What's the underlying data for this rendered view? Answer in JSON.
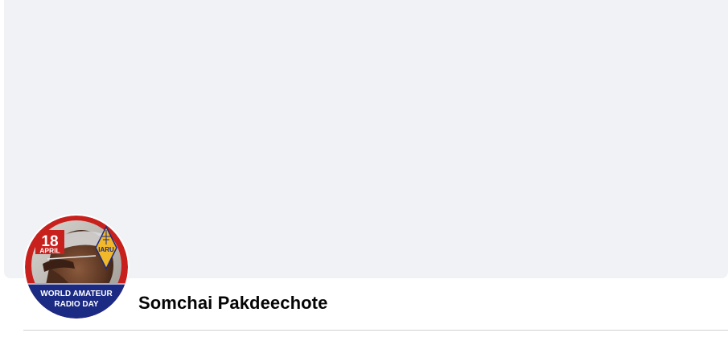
{
  "profile": {
    "name": "Somchai Pakdeechote",
    "avatar": {
      "badge_day": "18",
      "badge_month": "APRIL",
      "badge_logo": "IARU",
      "badge_line1": "WORLD AMATEUR",
      "badge_line2": "RADIO DAY"
    }
  },
  "colors": {
    "cover_bg": "#f0f2f5",
    "ring_red": "#c8201d",
    "band_blue": "#1b2a83",
    "logo_gold": "#f0b82a",
    "name_text": "#050505",
    "divider": "#ced0d4"
  }
}
